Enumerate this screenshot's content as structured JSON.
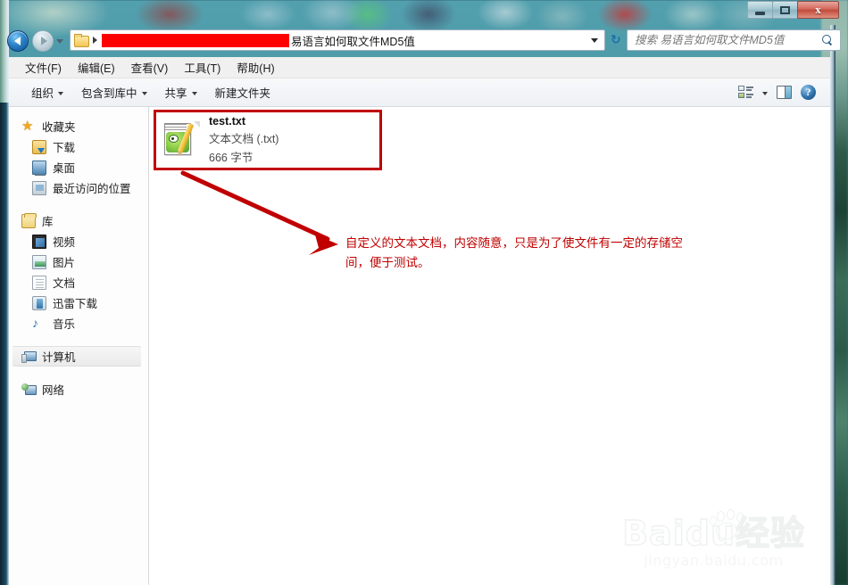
{
  "window": {
    "controls": {
      "minimize": "—",
      "maximize": "❐",
      "close": "x"
    }
  },
  "navigation": {
    "back_icon": "back-arrow-icon",
    "forward_icon": "forward-arrow-icon",
    "history_icon": "history-dropdown-icon",
    "refresh_icon": "refresh-icon",
    "refresh_glyph": "↻"
  },
  "address_bar": {
    "folder_icon": "folder-icon",
    "redacted": "",
    "path_text": "易语言如何取文件MD5值",
    "dropdown_icon": "chevron-down-icon"
  },
  "search": {
    "placeholder": "搜索 易语言如何取文件MD5值",
    "value": "",
    "icon": "search-icon"
  },
  "menubar": {
    "items": [
      {
        "label": "文件(F)"
      },
      {
        "label": "编辑(E)"
      },
      {
        "label": "查看(V)"
      },
      {
        "label": "工具(T)"
      },
      {
        "label": "帮助(H)"
      }
    ]
  },
  "toolbar": {
    "items": [
      {
        "label": "组织",
        "has_chevron": true
      },
      {
        "label": "包含到库中",
        "has_chevron": true
      },
      {
        "label": "共享",
        "has_chevron": true
      },
      {
        "label": "新建文件夹",
        "has_chevron": false
      }
    ],
    "view_icon": "view-options-icon",
    "view_chevron": "chevron-down-icon",
    "preview_pane_icon": "preview-pane-icon",
    "help_icon": "help-icon",
    "help_glyph": "?"
  },
  "sidebar": {
    "groups": [
      {
        "header": {
          "label": "收藏夹",
          "icon": "star-icon"
        },
        "items": [
          {
            "label": "下载",
            "icon": "downloads-icon"
          },
          {
            "label": "桌面",
            "icon": "desktop-icon"
          },
          {
            "label": "最近访问的位置",
            "icon": "recent-places-icon"
          }
        ]
      },
      {
        "header": {
          "label": "库",
          "icon": "library-icon"
        },
        "items": [
          {
            "label": "视频",
            "icon": "video-icon"
          },
          {
            "label": "图片",
            "icon": "pictures-icon"
          },
          {
            "label": "文档",
            "icon": "documents-icon"
          },
          {
            "label": "迅雷下载",
            "icon": "thunder-download-icon"
          },
          {
            "label": "音乐",
            "icon": "music-icon",
            "glyph": "♪"
          }
        ]
      },
      {
        "header": {
          "label": "计算机",
          "icon": "computer-icon",
          "selected": true
        },
        "items": []
      },
      {
        "header": {
          "label": "网络",
          "icon": "network-icon"
        },
        "items": []
      }
    ]
  },
  "file_list": {
    "items": [
      {
        "name": "test.txt",
        "type": "文本文档 (.txt)",
        "size": "666 字节",
        "icon": "text-document-icon",
        "highlighted": true
      }
    ]
  },
  "annotation": {
    "text": "自定义的文本文档，内容随意，只是为了使文件有一定的存储空间，便于测试。",
    "color": "#c00000",
    "arrow_icon": "annotation-arrow-icon",
    "highlight_box_color": "#c00000"
  },
  "watermark": {
    "main": "Baidu经验",
    "sub": "jingyan.baidu.com",
    "paw_icon": "baidu-paw-icon"
  },
  "colors": {
    "redaction": "#ff0000",
    "annotation": "#c00000",
    "accent": "#2f72ad"
  }
}
